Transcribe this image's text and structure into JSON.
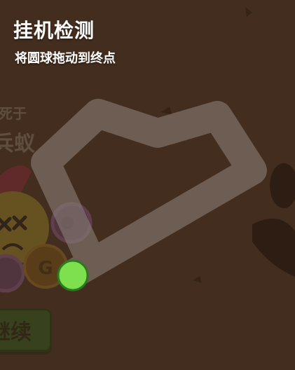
{
  "dialog": {
    "title": "挂机检测",
    "subtitle": "将圆球拖动到终点"
  },
  "background": {
    "death_label": "死于",
    "killer_name": "兵蚁",
    "continue_label": "继续",
    "coin_symbol": "G"
  },
  "colors": {
    "overlay": "#3a2618",
    "path": "#8f857d",
    "ball": "#7ee04f",
    "ball_border": "#2b7a1f"
  }
}
